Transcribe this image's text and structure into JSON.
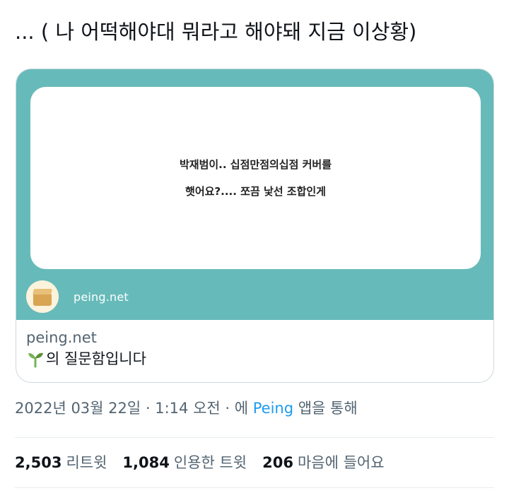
{
  "tweet": {
    "text": "... ( 나 어떡해야대 뭐라고 해야돼 지금 이상황)"
  },
  "card": {
    "question_lines": [
      "박재범이.. 십점만점의십점 커버를",
      "햇어요?.... 쪼끔 낯선 조합인게"
    ],
    "image_domain": "peing.net",
    "domain": "peing.net",
    "title": "의 질문함입니다",
    "title_icon": "sprout-icon"
  },
  "timestamp": {
    "date": "2022년 03월 22일",
    "sep1": " · ",
    "time": "1:14 오전",
    "sep2": " · ",
    "via_prefix": "에 ",
    "app": "Peing",
    "via_suffix": " 앱을 통해"
  },
  "stats": [
    {
      "count": "2,503",
      "label": "리트윗"
    },
    {
      "count": "1,084",
      "label": "인용한 트윗"
    },
    {
      "count": "206",
      "label": "마음에 들어요"
    }
  ],
  "colors": {
    "card_teal": "#67baba",
    "link_blue": "#1d9bf0",
    "secondary_text": "#536471"
  }
}
